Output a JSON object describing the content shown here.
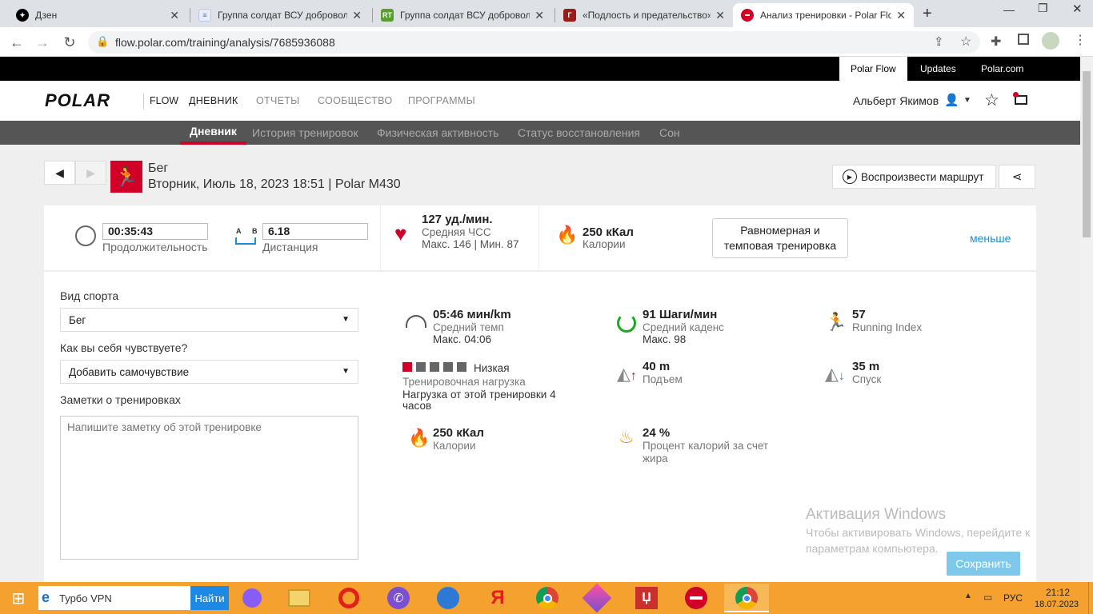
{
  "browser": {
    "tabs": [
      {
        "title": "Дзен",
        "active": false
      },
      {
        "title": "Группа солдат ВСУ доброволь",
        "active": false
      },
      {
        "title": "Группа солдат ВСУ доброволь",
        "active": false
      },
      {
        "title": "«Подлость и предательство»:",
        "active": false
      },
      {
        "title": "Анализ тренировки - Polar Flo",
        "active": true
      }
    ],
    "new_tab": "+",
    "url": "flow.polar.com/training/analysis/7685936088"
  },
  "topbar": {
    "links": [
      "Polar Flow",
      "Updates",
      "Polar.com"
    ]
  },
  "mainnav": {
    "logo": "POLAR",
    "flow": "FLOW",
    "items": [
      "ДНЕВНИК",
      "ОТЧЕТЫ",
      "СООБЩЕСТВО",
      "ПРОГРАММЫ"
    ],
    "user": "Альберт Якимов"
  },
  "subnav": {
    "items": [
      "Дневник",
      "История тренировок",
      "Физическая активность",
      "Статус восстановления",
      "Сон"
    ]
  },
  "header": {
    "sport": "Бег",
    "subtitle": "Вторник, Июль 18, 2023 18:51 | Polar M430",
    "play_route": "Воспроизвести маршрут"
  },
  "summary": {
    "duration_value": "00:35:43",
    "duration_label": "Продолжительность",
    "distance_value": "6.18",
    "distance_label": "Дистанция",
    "ab_a": "A",
    "ab_b": "B",
    "hr_value": "127 уд./мин.",
    "hr_label": "Средняя ЧСС",
    "hr_minmax": "Макс. 146  |  Мин. 87",
    "cal_value": "250 кКал",
    "cal_label": "Калории",
    "type_button": "Равномерная и темповая тренировка",
    "less": "меньше"
  },
  "form": {
    "sport_label": "Вид спорта",
    "sport_value": "Бег",
    "feel_label": "Как вы себя чувствуете?",
    "feel_value": "Добавить самочувствие",
    "notes_label": "Заметки о тренировках",
    "notes_placeholder": "Напишите заметку об этой тренировке"
  },
  "stats": {
    "pace_value": "05:46 мин/km",
    "pace_label": "Средний темп",
    "pace_max": "Макс. 04:06",
    "cadence_value": "91 Шаги/мин",
    "cadence_label": "Средний каденс",
    "cadence_max": "Макс. 98",
    "ri_value": "57",
    "ri_label": "Running Index",
    "load_level": "Низкая",
    "load_label": "Тренировочная нагрузка",
    "load_desc": "Нагрузка от этой тренировки 4 часов",
    "ascent_value": "40 m",
    "ascent_label": "Подъем",
    "descent_value": "35 m",
    "descent_label": "Спуск",
    "cal_value": "250 кКал",
    "cal_label": "Калории",
    "fat_value": "24 %",
    "fat_label": "Процент калорий за счет жира",
    "load_bars_filled": 1,
    "load_bars_total": 5
  },
  "save_button": "Сохранить",
  "watermark": {
    "title": "Активация Windows",
    "line1": "Чтобы активировать Windows, перейдите к",
    "line2": "параметрам компьютера."
  },
  "taskbar": {
    "search_text": "Турбо VPN",
    "search_button": "Найти",
    "lang": "РУС",
    "time": "21:12",
    "date": "18.07.2023"
  },
  "colors": {
    "accent": "#d10027",
    "link": "#1a8fd6",
    "taskbar": "#f4a12f",
    "save": "#7ec8ec"
  }
}
